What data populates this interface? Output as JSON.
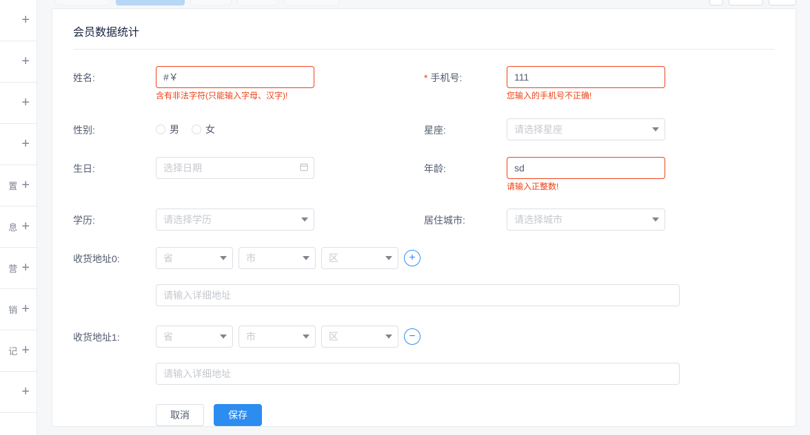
{
  "page": {
    "title": "会员数据统计"
  },
  "labels": {
    "name": "姓名:",
    "phone": "手机号:",
    "gender": "性别:",
    "zodiac": "星座:",
    "birthday": "生日:",
    "age": "年龄:",
    "education": "学历:",
    "city": "居住城市:",
    "addr0": "收货地址0:",
    "addr1": "收货地址1:"
  },
  "gender": {
    "male": "男",
    "female": "女"
  },
  "inputs": {
    "name_value": "#￥",
    "name_placeholder": "",
    "phone_value": "111",
    "age_value": "sd",
    "birthday_placeholder": "选择日期",
    "zodiac_placeholder": "请选择星座",
    "education_placeholder": "请选择学历",
    "city_placeholder": "请选择城市",
    "province_placeholder": "省",
    "city2_placeholder": "市",
    "district_placeholder": "区",
    "detail_placeholder": "请输入详细地址"
  },
  "errors": {
    "name": "含有非法字符(只能输入字母、汉字)!",
    "phone": "您输入的手机号不正确!",
    "age": "请输入正整数!"
  },
  "buttons": {
    "cancel": "取消",
    "save": "保存"
  },
  "sidebar": [
    "",
    "",
    "",
    "",
    "置",
    "息",
    "营",
    "销",
    "记",
    ""
  ]
}
